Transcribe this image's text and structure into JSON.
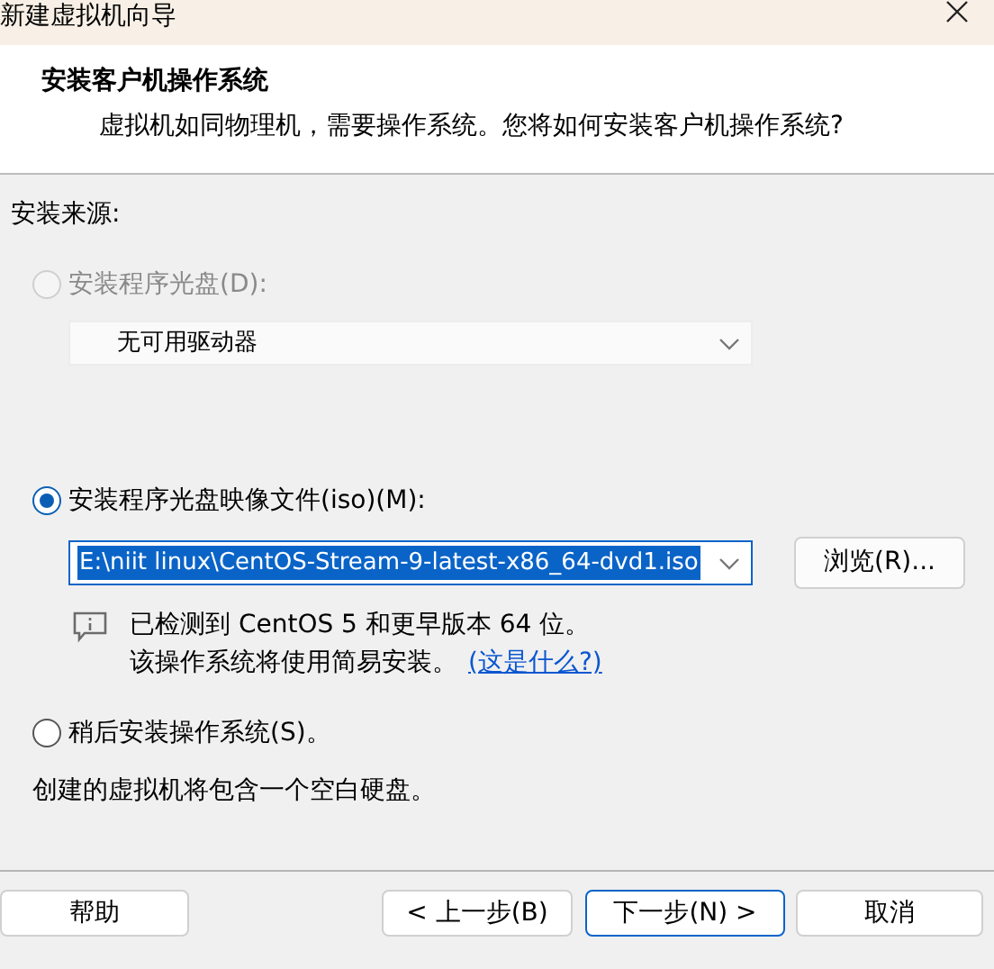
{
  "window": {
    "title": "新建虚拟机向导"
  },
  "header": {
    "title": "安装客户机操作系统",
    "subtitle": "虚拟机如同物理机，需要操作系统。您将如何安装客户机操作系统?"
  },
  "source_label": "安装来源:",
  "options": [
    {
      "label": "安装程序光盘(D):",
      "selected": false,
      "disabled": true,
      "dropdown": {
        "value": "无可用驱动器",
        "highlighted": false
      }
    },
    {
      "label": "安装程序光盘映像文件(iso)(M):",
      "selected": true,
      "disabled": false,
      "dropdown": {
        "value": "E:\\niit linux\\CentOS-Stream-9-latest-x86_64-dvd1.iso",
        "highlighted": true
      },
      "browse_button": "浏览(R)...",
      "info": {
        "line1": "已检测到 CentOS 5 和更早版本 64 位。",
        "line2": "该操作系统将使用简易安装。",
        "link": "(这是什么?)"
      }
    },
    {
      "label": "稍后安装操作系统(S)。",
      "selected": false,
      "disabled": false,
      "note": "创建的虚拟机将包含一个空白硬盘。"
    }
  ],
  "buttons": [
    {
      "label": "帮助",
      "default": false
    },
    {
      "label": "< 上一步(B)",
      "default": false
    },
    {
      "label": "下一步(N) >",
      "default": true
    },
    {
      "label": "取消",
      "default": false
    }
  ]
}
